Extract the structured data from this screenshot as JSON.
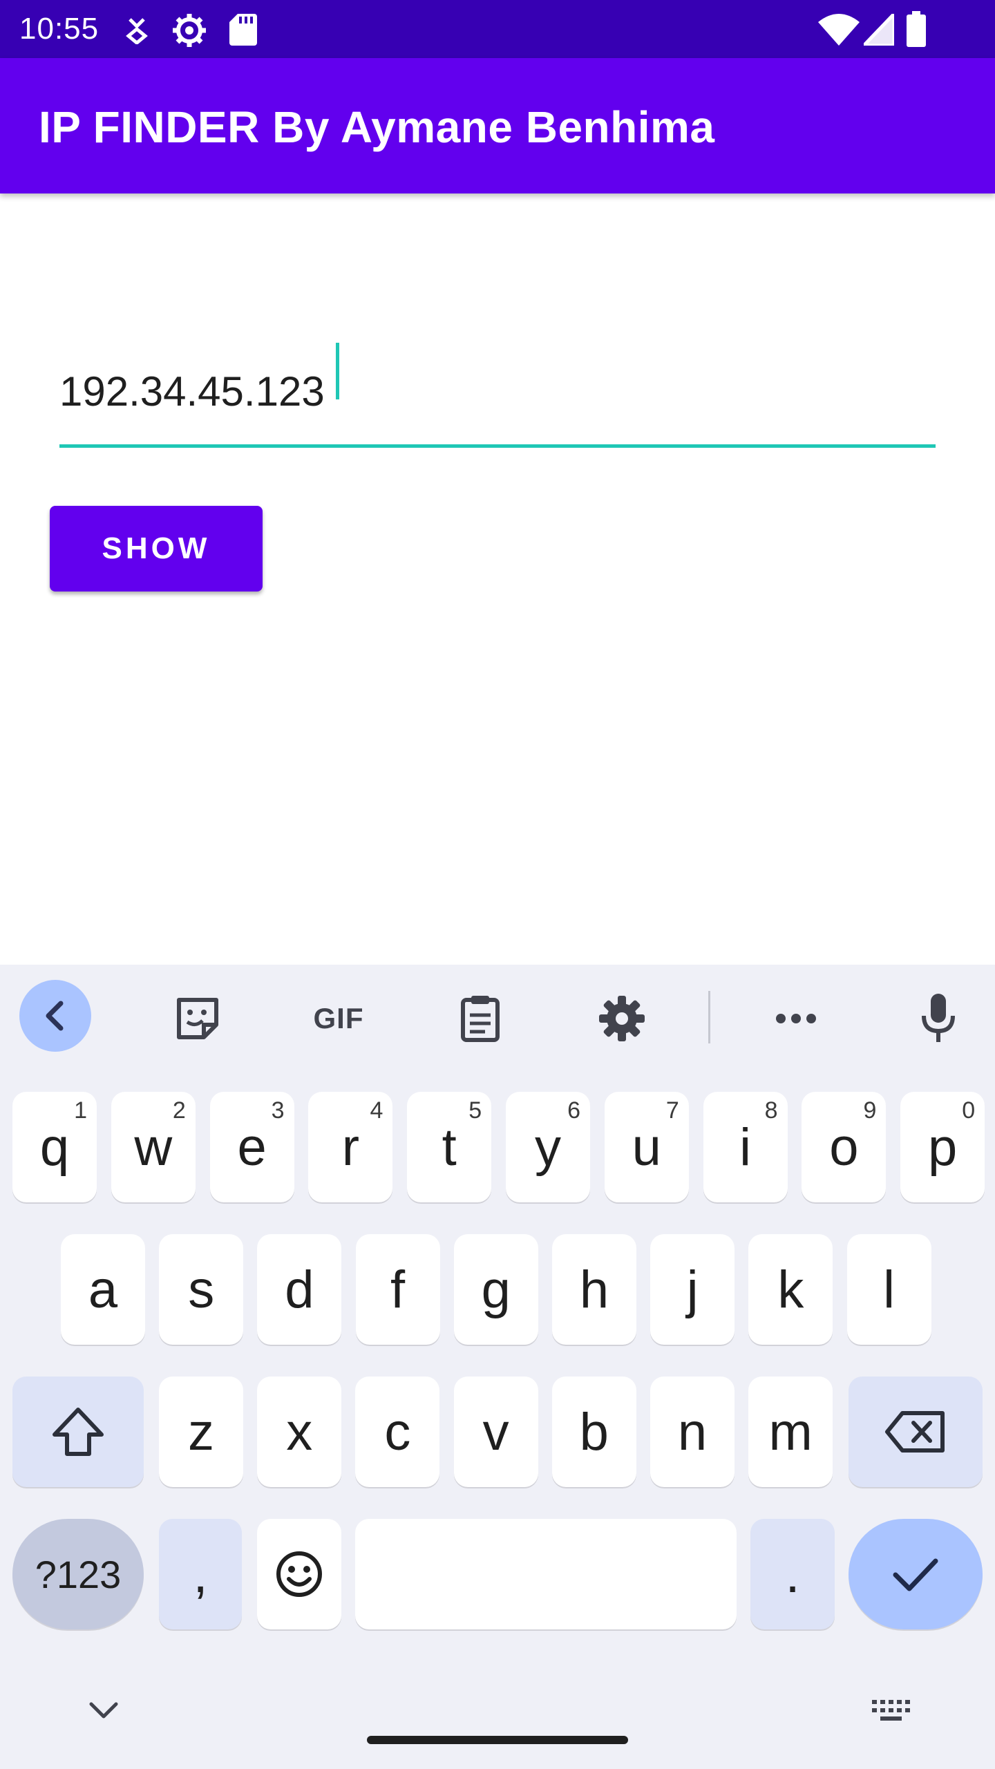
{
  "status_bar": {
    "time": "10:55",
    "left_icons": [
      "network-speed-icon",
      "settings-gear-icon",
      "sd-card-icon"
    ],
    "right_icons": [
      "wifi-icon",
      "signal-icon",
      "battery-icon"
    ]
  },
  "app_bar": {
    "title": "IP FINDER By Aymane Benhima"
  },
  "ip_input": {
    "value": "192.34.45.123"
  },
  "show_button": {
    "label": "SHOW"
  },
  "keyboard": {
    "toolbar": {
      "items": [
        "back-chevron-icon",
        "sticker-icon",
        "GIF",
        "clipboard-icon",
        "settings-gear-icon",
        "more-icon",
        "mic-icon"
      ],
      "gif_label": "GIF"
    },
    "row1": [
      {
        "key": "q",
        "hint": "1"
      },
      {
        "key": "w",
        "hint": "2"
      },
      {
        "key": "e",
        "hint": "3"
      },
      {
        "key": "r",
        "hint": "4"
      },
      {
        "key": "t",
        "hint": "5"
      },
      {
        "key": "y",
        "hint": "6"
      },
      {
        "key": "u",
        "hint": "7"
      },
      {
        "key": "i",
        "hint": "8"
      },
      {
        "key": "o",
        "hint": "9"
      },
      {
        "key": "p",
        "hint": "0"
      }
    ],
    "row2": [
      "a",
      "s",
      "d",
      "f",
      "g",
      "h",
      "j",
      "k",
      "l"
    ],
    "row3": [
      "z",
      "x",
      "c",
      "v",
      "b",
      "n",
      "m"
    ],
    "row4": {
      "symbols": "?123",
      "comma": ",",
      "period": "."
    },
    "accent_color": "#aac4ff"
  },
  "colors": {
    "status_bar": "#3700b3",
    "app_bar": "#6200ee",
    "input_underline": "#1fc7b5",
    "button": "#6200ee"
  }
}
